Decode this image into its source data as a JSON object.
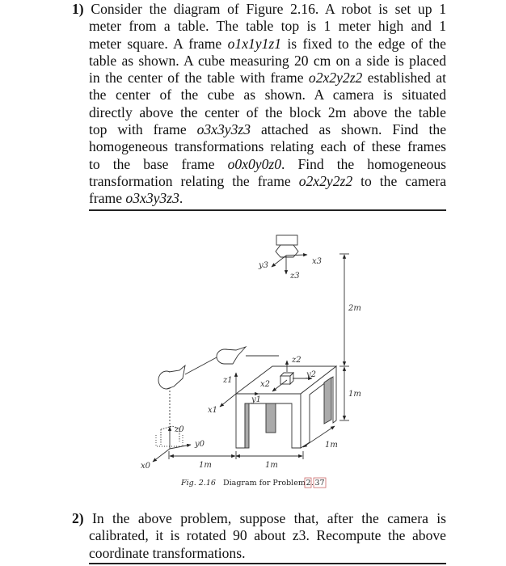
{
  "problem1": {
    "number": "1)",
    "lines": [
      "Consider the diagram of Figure 2.16. A robot is set up 1",
      "meter from a table. The table top is 1 meter high and 1",
      [
        "meter square. A frame ",
        "o1x1y1z1",
        " is fixed to the edge of the"
      ],
      "table as shown. A cube measuring 20 cm on a side is placed",
      [
        "in the center of the table with frame ",
        "o2x2y2z2",
        " established at"
      ],
      "the center of the cube as shown. A camera is situated",
      "directly above the center of the block 2m above the table",
      [
        "top with frame ",
        "o3x3y3z3",
        " attached as shown. Find the"
      ],
      "homogeneous transformations relating each of these frames",
      [
        "to the base frame ",
        "o0x0y0z0",
        ". Find the homogeneous"
      ],
      [
        "transformation relating the frame ",
        "o2x2y2z2",
        " to the camera"
      ],
      [
        "frame ",
        "o3x3y3z3",
        "."
      ]
    ]
  },
  "figure": {
    "caption_prefix": "Fig. 2.16",
    "caption_text": "Diagram for Problem",
    "caption_ref_a": "2",
    "caption_ref_b": "37",
    "labels": {
      "x3": "x3",
      "y3": "y3",
      "z3": "z3",
      "x2": "x2",
      "y2": "y2",
      "z2": "z2",
      "x1": "x1",
      "y1": "y1",
      "z1": "z1",
      "x0": "x0",
      "y0": "y0",
      "z0": "z0",
      "dim_camera_height": "2m",
      "dim_table_height": "1m",
      "dim_table_depth": "1m",
      "dim_robot_to_table": "1m",
      "dim_table_width": "1m"
    }
  },
  "problem2": {
    "number": "2)",
    "lines": [
      "In the above problem, suppose that, after the camera is",
      "calibrated, it is rotated 90 about z3. Recompute the above",
      "coordinate transformations."
    ]
  }
}
